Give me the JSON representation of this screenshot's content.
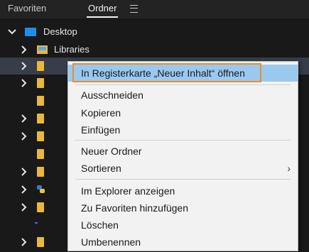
{
  "tabs": [
    {
      "label": "Favoriten",
      "active": false
    },
    {
      "label": "Ordner",
      "active": true
    }
  ],
  "tree": {
    "desktop_label": "Desktop",
    "libraries_label": "Libraries"
  },
  "context_menu": {
    "items": [
      {
        "label": "In Registerkarte „Neuer Inhalt“ öffnen",
        "highlighted": true
      },
      {
        "label": "Ausschneiden"
      },
      {
        "label": "Kopieren"
      },
      {
        "label": "Einfügen"
      },
      {
        "label": "Neuer Ordner"
      },
      {
        "label": "Sortieren",
        "submenu": true
      },
      {
        "label": "Im Explorer anzeigen"
      },
      {
        "label": "Zu Favoriten hinzufügen"
      },
      {
        "label": "Löschen"
      },
      {
        "label": "Umbenennen"
      }
    ]
  },
  "colors": {
    "background": "#191919",
    "selection": "#373d49",
    "menu_highlight": "#9ac9f0",
    "highlight_outline": "#f08a24",
    "folder": "#e8b93a",
    "desktop_icon": "#1e8ee8"
  }
}
